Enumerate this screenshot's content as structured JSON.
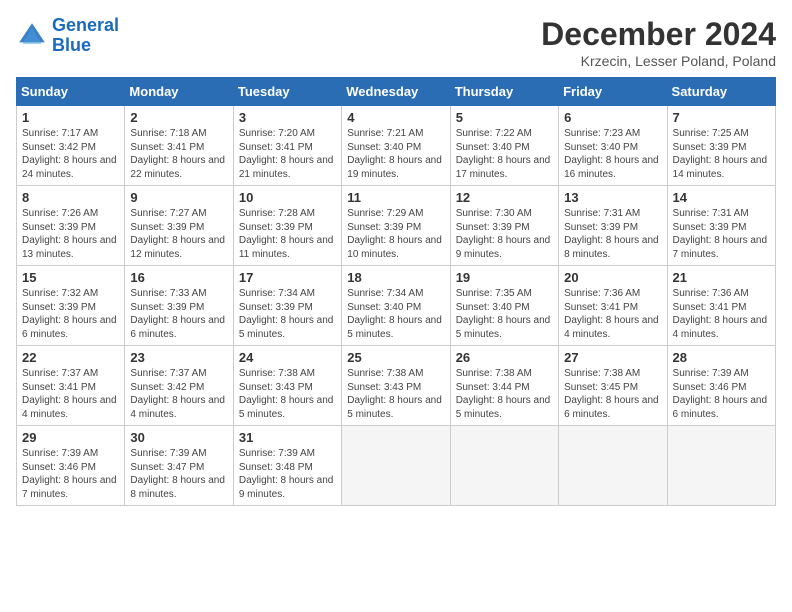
{
  "header": {
    "logo_line1": "General",
    "logo_line2": "Blue",
    "month": "December 2024",
    "location": "Krzecin, Lesser Poland, Poland"
  },
  "weekdays": [
    "Sunday",
    "Monday",
    "Tuesday",
    "Wednesday",
    "Thursday",
    "Friday",
    "Saturday"
  ],
  "weeks": [
    [
      {
        "day": "1",
        "info": "Sunrise: 7:17 AM\nSunset: 3:42 PM\nDaylight: 8 hours and 24 minutes."
      },
      {
        "day": "2",
        "info": "Sunrise: 7:18 AM\nSunset: 3:41 PM\nDaylight: 8 hours and 22 minutes."
      },
      {
        "day": "3",
        "info": "Sunrise: 7:20 AM\nSunset: 3:41 PM\nDaylight: 8 hours and 21 minutes."
      },
      {
        "day": "4",
        "info": "Sunrise: 7:21 AM\nSunset: 3:40 PM\nDaylight: 8 hours and 19 minutes."
      },
      {
        "day": "5",
        "info": "Sunrise: 7:22 AM\nSunset: 3:40 PM\nDaylight: 8 hours and 17 minutes."
      },
      {
        "day": "6",
        "info": "Sunrise: 7:23 AM\nSunset: 3:40 PM\nDaylight: 8 hours and 16 minutes."
      },
      {
        "day": "7",
        "info": "Sunrise: 7:25 AM\nSunset: 3:39 PM\nDaylight: 8 hours and 14 minutes."
      }
    ],
    [
      {
        "day": "8",
        "info": "Sunrise: 7:26 AM\nSunset: 3:39 PM\nDaylight: 8 hours and 13 minutes."
      },
      {
        "day": "9",
        "info": "Sunrise: 7:27 AM\nSunset: 3:39 PM\nDaylight: 8 hours and 12 minutes."
      },
      {
        "day": "10",
        "info": "Sunrise: 7:28 AM\nSunset: 3:39 PM\nDaylight: 8 hours and 11 minutes."
      },
      {
        "day": "11",
        "info": "Sunrise: 7:29 AM\nSunset: 3:39 PM\nDaylight: 8 hours and 10 minutes."
      },
      {
        "day": "12",
        "info": "Sunrise: 7:30 AM\nSunset: 3:39 PM\nDaylight: 8 hours and 9 minutes."
      },
      {
        "day": "13",
        "info": "Sunrise: 7:31 AM\nSunset: 3:39 PM\nDaylight: 8 hours and 8 minutes."
      },
      {
        "day": "14",
        "info": "Sunrise: 7:31 AM\nSunset: 3:39 PM\nDaylight: 8 hours and 7 minutes."
      }
    ],
    [
      {
        "day": "15",
        "info": "Sunrise: 7:32 AM\nSunset: 3:39 PM\nDaylight: 8 hours and 6 minutes."
      },
      {
        "day": "16",
        "info": "Sunrise: 7:33 AM\nSunset: 3:39 PM\nDaylight: 8 hours and 6 minutes."
      },
      {
        "day": "17",
        "info": "Sunrise: 7:34 AM\nSunset: 3:39 PM\nDaylight: 8 hours and 5 minutes."
      },
      {
        "day": "18",
        "info": "Sunrise: 7:34 AM\nSunset: 3:40 PM\nDaylight: 8 hours and 5 minutes."
      },
      {
        "day": "19",
        "info": "Sunrise: 7:35 AM\nSunset: 3:40 PM\nDaylight: 8 hours and 5 minutes."
      },
      {
        "day": "20",
        "info": "Sunrise: 7:36 AM\nSunset: 3:41 PM\nDaylight: 8 hours and 4 minutes."
      },
      {
        "day": "21",
        "info": "Sunrise: 7:36 AM\nSunset: 3:41 PM\nDaylight: 8 hours and 4 minutes."
      }
    ],
    [
      {
        "day": "22",
        "info": "Sunrise: 7:37 AM\nSunset: 3:41 PM\nDaylight: 8 hours and 4 minutes."
      },
      {
        "day": "23",
        "info": "Sunrise: 7:37 AM\nSunset: 3:42 PM\nDaylight: 8 hours and 4 minutes."
      },
      {
        "day": "24",
        "info": "Sunrise: 7:38 AM\nSunset: 3:43 PM\nDaylight: 8 hours and 5 minutes."
      },
      {
        "day": "25",
        "info": "Sunrise: 7:38 AM\nSunset: 3:43 PM\nDaylight: 8 hours and 5 minutes."
      },
      {
        "day": "26",
        "info": "Sunrise: 7:38 AM\nSunset: 3:44 PM\nDaylight: 8 hours and 5 minutes."
      },
      {
        "day": "27",
        "info": "Sunrise: 7:38 AM\nSunset: 3:45 PM\nDaylight: 8 hours and 6 minutes."
      },
      {
        "day": "28",
        "info": "Sunrise: 7:39 AM\nSunset: 3:46 PM\nDaylight: 8 hours and 6 minutes."
      }
    ],
    [
      {
        "day": "29",
        "info": "Sunrise: 7:39 AM\nSunset: 3:46 PM\nDaylight: 8 hours and 7 minutes."
      },
      {
        "day": "30",
        "info": "Sunrise: 7:39 AM\nSunset: 3:47 PM\nDaylight: 8 hours and 8 minutes."
      },
      {
        "day": "31",
        "info": "Sunrise: 7:39 AM\nSunset: 3:48 PM\nDaylight: 8 hours and 9 minutes."
      },
      {
        "day": "",
        "info": ""
      },
      {
        "day": "",
        "info": ""
      },
      {
        "day": "",
        "info": ""
      },
      {
        "day": "",
        "info": ""
      }
    ]
  ]
}
